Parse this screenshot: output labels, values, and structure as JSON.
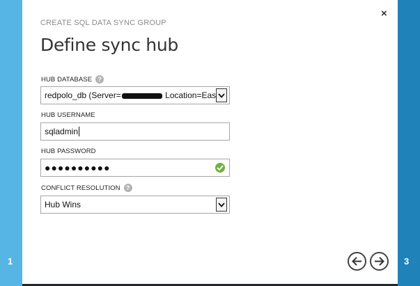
{
  "wizard": {
    "header": "CREATE SQL DATA SYNC GROUP",
    "title": "Define sync hub",
    "close_symbol": "×",
    "step_prev": "1",
    "step_next": "3"
  },
  "form": {
    "hub_database": {
      "label": "HUB DATABASE",
      "value_start": "redpolo_db (Server=",
      "value_end": " Location=East"
    },
    "hub_username": {
      "label": "HUB USERNAME",
      "value": "sqladmin"
    },
    "hub_password": {
      "label": "HUB PASSWORD",
      "value": "●●●●●●●●●●"
    },
    "conflict_resolution": {
      "label": "CONFLICT RESOLUTION",
      "value": "Hub Wins"
    }
  },
  "icons": {
    "help": "question-circle",
    "valid": "check-circle",
    "prev": "arrow-left-circle",
    "next": "arrow-right-circle"
  },
  "colors": {
    "step_left": "#57b5e6",
    "step_right": "#1f82b8",
    "valid_green": "#6cb33e"
  }
}
